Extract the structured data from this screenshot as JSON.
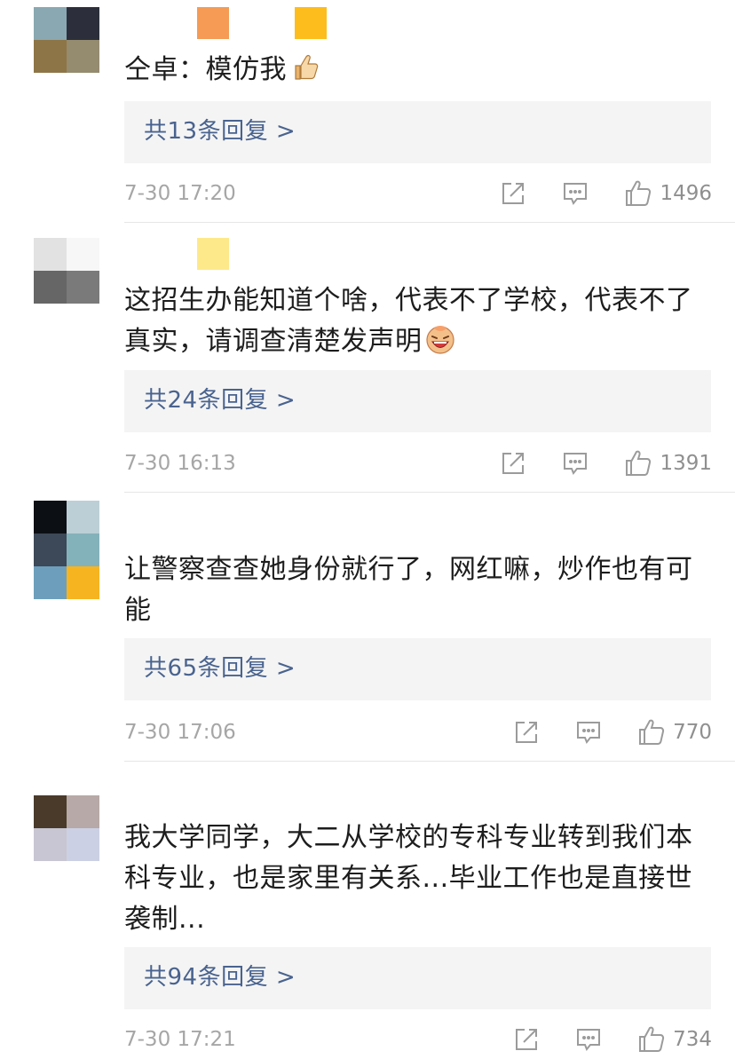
{
  "colors": {
    "reply_link": "#49638f",
    "meta_text": "#a6a6a6",
    "reply_bg": "#f4f4f4"
  },
  "comments": [
    {
      "username_colors": [
        "#f59b56",
        "#fdbd1c"
      ],
      "avatar_colors": [
        "#8aa8b1",
        "#2c2f3b",
        "#8e7547",
        "#958b6f"
      ],
      "text": "仝卓：模仿我",
      "emoji": "thumbs-up",
      "replies": "共13条回复 >",
      "time": "7-30 17:20",
      "likes": "1496"
    },
    {
      "username_colors": [
        "#fde98a"
      ],
      "avatar_colors": [
        "#e2e2e2",
        "#f7f7f7",
        "#666666",
        "#7a7a7a"
      ],
      "text": "这招生办能知道个啥，代表不了学校，代表不了真实，请调查清楚发声明",
      "emoji": "laughing-face",
      "replies": "共24条回复 >",
      "time": "7-30 16:13",
      "likes": "1391"
    },
    {
      "username_colors": [],
      "avatar_colors": [
        "#0c0f14",
        "#bccfd6",
        "#3d4858",
        "#84b2bb",
        "#6d9fbc",
        "#f7b421"
      ],
      "text": "让警察查查她身份就行了，网红嘛，炒作也有可能",
      "emoji": "",
      "replies": "共65条回复 >",
      "time": "7-30 17:06",
      "likes": "770"
    },
    {
      "username_colors": [],
      "avatar_colors": [
        "#4a3a2a",
        "#b7a9a7",
        "#c8c6d2",
        "#ccd0e4"
      ],
      "text": "我大学同学，大二从学校的专科专业转到我们本科专业，也是家里有关系...毕业工作也是直接世袭制...",
      "emoji": "",
      "replies": "共94条回复 >",
      "time": "7-30 17:21",
      "likes": "734"
    }
  ]
}
